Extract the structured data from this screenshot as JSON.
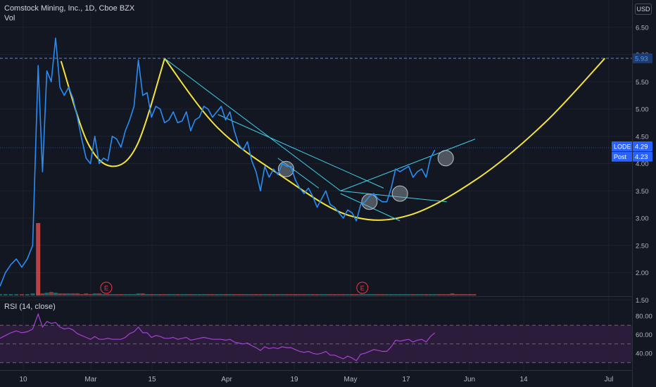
{
  "header": {
    "symbol_title": "Comstock Mining, Inc., 1D, Cboe BZX",
    "volume_label": "Vol",
    "currency": "USD"
  },
  "colors": {
    "background": "#131722",
    "price_line": "#2a8cf3",
    "cup_curve": "#f5e43a",
    "trendline": "#3fd0e8",
    "volume_up": "#26a69a",
    "volume_down": "#ef5350",
    "rsi_line": "#a742d3",
    "rsi_band": "#2d1d3d",
    "earnings_marker": "#f23645",
    "axis_label_bg": "#2962ff"
  },
  "chart_data": [
    {
      "type": "line",
      "title": "Comstock Mining, Inc., 1D, Cboe BZX",
      "series_name": "LODE",
      "y_axis": {
        "ticks": [
          "6.50",
          "6.00",
          "5.50",
          "5.00",
          "4.50",
          "4.00",
          "3.50",
          "3.00",
          "2.50",
          "2.00",
          "1.50"
        ],
        "ylim": [
          1.4,
          6.6
        ],
        "scale": "linear"
      },
      "x_axis": {
        "tick_labels": [
          "10",
          "Mar",
          "15",
          "Apr",
          "19",
          "May",
          "17",
          "Jun",
          "14",
          "Jul"
        ],
        "xlim": [
          0,
          116
        ]
      },
      "price": {
        "x": [
          0,
          1,
          2,
          3,
          4,
          5,
          6,
          7,
          7.8,
          8.6,
          9.4,
          10.2,
          11,
          11.8,
          12.6,
          13.4,
          14.2,
          15,
          15.8,
          16.6,
          17.4,
          18.2,
          19,
          19.8,
          20.6,
          21.4,
          22.2,
          23,
          23.8,
          24.6,
          25.4,
          26.2,
          27,
          27.8,
          28.6,
          29.4,
          30.2,
          31,
          31.8,
          32.6,
          33.4,
          34.2,
          35,
          35.8,
          36.6,
          37.4,
          38.2,
          39,
          39.8,
          40.6,
          41.4,
          42.2,
          43,
          43.8,
          44.6,
          45.4,
          46.2,
          47,
          47.8,
          48.6,
          49.4,
          50.2,
          51,
          51.8,
          52.6,
          53.4,
          54.2,
          55,
          55.8,
          56.6,
          57.4,
          58.2,
          59,
          59.8,
          60.6,
          61.4,
          62.2,
          63,
          63.8,
          64.6,
          65.4,
          66.2,
          67,
          67.8,
          68.6,
          69.4,
          70.2,
          71,
          71.8,
          72.6,
          73.4,
          74.2,
          75,
          75.8,
          76.6,
          77.4,
          78.2,
          79,
          79.8,
          80.6,
          81.4,
          82.2,
          83,
          83.8,
          84.6,
          85.4,
          86.2,
          87
        ],
        "close": [
          1.75,
          2.0,
          2.15,
          2.25,
          2.1,
          2.25,
          2.5,
          5.8,
          3.85,
          5.7,
          5.5,
          6.3,
          5.4,
          5.25,
          5.4,
          5.2,
          4.85,
          4.45,
          4.1,
          4.0,
          4.5,
          4.0,
          4.1,
          4.05,
          4.5,
          4.45,
          4.3,
          4.6,
          4.8,
          5.05,
          5.9,
          5.25,
          5.3,
          4.85,
          5.05,
          5.0,
          4.75,
          4.8,
          4.95,
          4.75,
          4.78,
          4.95,
          4.6,
          4.8,
          4.85,
          5.05,
          5.0,
          4.85,
          4.95,
          5.05,
          4.8,
          4.95,
          4.6,
          4.35,
          4.25,
          4.4,
          4.05,
          3.85,
          3.5,
          3.95,
          3.75,
          3.9,
          3.8,
          4.0,
          3.95,
          3.95,
          3.7,
          3.55,
          3.45,
          3.55,
          3.4,
          3.2,
          3.35,
          3.5,
          3.25,
          3.2,
          3.1,
          3.0,
          3.15,
          3.1,
          2.95,
          3.25,
          3.3,
          3.4,
          3.45,
          3.35,
          3.3,
          3.3,
          3.55,
          3.9,
          3.85,
          3.9,
          3.95,
          3.75,
          3.85,
          3.9,
          3.75,
          4.1,
          4.25
        ]
      },
      "annotations": {
        "resistance_level": 5.93,
        "resistance_label": "5.93",
        "last_price_label": "4.29",
        "post_price_label": "4.23",
        "symbol_label": "LODE",
        "post_label": "Post",
        "last_price": 4.29,
        "post_price": 4.23,
        "small_cup": [
          [
            11.2,
            5.88
          ],
          [
            16,
            4.4
          ],
          [
            20.6,
            3.95
          ],
          [
            25.2,
            4.35
          ],
          [
            30.2,
            5.92
          ]
        ],
        "large_cup": [
          [
            30.2,
            5.93
          ],
          [
            40,
            4.65
          ],
          [
            52,
            3.75
          ],
          [
            64,
            3.05
          ],
          [
            75,
            3.05
          ],
          [
            88,
            3.75
          ],
          [
            100,
            4.75
          ],
          [
            111,
            5.93
          ]
        ],
        "trendlines": [
          [
            [
              30.2,
              5.93
            ],
            [
              62.5,
              3.5
            ]
          ],
          [
            [
              40,
              4.9
            ],
            [
              70.4,
              3.55
            ]
          ],
          [
            [
              51,
              4.1
            ],
            [
              58.5,
              3.55
            ]
          ],
          [
            [
              62.5,
              3.5
            ],
            [
              87.2,
              4.45
            ]
          ],
          [
            [
              62.5,
              3.5
            ],
            [
              82,
              3.3
            ]
          ],
          [
            [
              62.5,
              3.45
            ],
            [
              73.4,
              2.95
            ]
          ]
        ],
        "highlight_circles": [
          [
            52.5,
            3.9
          ],
          [
            67.8,
            3.3
          ],
          [
            73.4,
            3.45
          ],
          [
            81.8,
            4.1
          ]
        ]
      }
    },
    {
      "type": "bar",
      "title": "Vol",
      "highlighted_bar_index": 7,
      "bar_x": [
        0,
        1,
        2,
        3,
        4,
        5,
        6,
        7,
        7.8,
        8.6,
        9.4,
        10.2,
        11,
        11.8,
        12.6,
        13.4,
        14.2,
        15,
        15.8,
        16.6,
        17.4,
        18.2,
        19,
        19.8,
        20.6,
        21.4,
        22.2,
        23,
        23.8,
        24.6,
        25.4,
        26.2,
        27,
        27.8,
        28.6,
        29.4,
        30.2,
        31,
        31.8,
        32.6,
        33.4,
        34.2,
        35,
        35.8,
        36.6,
        37.4,
        38.2,
        39,
        39.8,
        40.6,
        41.4,
        42.2,
        43,
        43.8,
        44.6,
        45.4,
        46.2,
        47,
        47.8,
        48.6,
        49.4,
        50.2,
        51,
        51.8,
        52.6,
        53.4,
        54.2,
        55,
        55.8,
        56.6,
        57.4,
        58.2,
        59,
        59.8,
        60.6,
        61.4,
        62.2,
        63,
        63.8,
        64.6,
        65.4,
        66.2,
        67,
        67.8,
        68.6,
        69.4,
        70.2,
        71,
        71.8,
        72.6,
        73.4,
        74.2,
        75,
        75.8,
        76.6,
        77.4,
        78.2,
        79,
        79.8,
        80.6,
        81.4,
        82.2,
        83,
        83.8,
        84.6,
        85.4,
        86.2,
        87
      ],
      "volume_relative": [
        0.02,
        0.02,
        0.02,
        0.02,
        0.02,
        0.02,
        0.03,
        1.0,
        0.03,
        0.04,
        0.05,
        0.04,
        0.03,
        0.03,
        0.03,
        0.03,
        0.03,
        0.02,
        0.03,
        0.02,
        0.03,
        0.03,
        0.02,
        0.02,
        0.02,
        0.02,
        0.02,
        0.02,
        0.02,
        0.02,
        0.03,
        0.03,
        0.02,
        0.02,
        0.02,
        0.02,
        0.02,
        0.02,
        0.02,
        0.02,
        0.02,
        0.02,
        0.02,
        0.02,
        0.02,
        0.02,
        0.02,
        0.02,
        0.02,
        0.02,
        0.02,
        0.02,
        0.02,
        0.02,
        0.02,
        0.02,
        0.02,
        0.02,
        0.02,
        0.02,
        0.02,
        0.02,
        0.02,
        0.02,
        0.02,
        0.02,
        0.02,
        0.02,
        0.02,
        0.02,
        0.02,
        0.02,
        0.02,
        0.02,
        0.02,
        0.02,
        0.02,
        0.02,
        0.02,
        0.02,
        0.02,
        0.02,
        0.02,
        0.02,
        0.02,
        0.02,
        0.02,
        0.02,
        0.02,
        0.02,
        0.02,
        0.02,
        0.02,
        0.02,
        0.02,
        0.02,
        0.02,
        0.02,
        0.02,
        0.02,
        0.02,
        0.02,
        0.03,
        0.02,
        0.02,
        0.02,
        0.02,
        0.02,
        0.02
      ],
      "volume_up": [
        true,
        true,
        true,
        true,
        false,
        true,
        true,
        false,
        false,
        true,
        false,
        true,
        false,
        false,
        true,
        false,
        false,
        false,
        false,
        false,
        true,
        false,
        true,
        false,
        true,
        false,
        false,
        true,
        true,
        true,
        true,
        false,
        true,
        false,
        true,
        false,
        false,
        true,
        true,
        false,
        true,
        true,
        false,
        true,
        true,
        true,
        false,
        false,
        true,
        true,
        false,
        true,
        false,
        false,
        false,
        true,
        false,
        false,
        false,
        true,
        false,
        true,
        false,
        true,
        false,
        false,
        false,
        false,
        false,
        true,
        false,
        false,
        true,
        true,
        false,
        false,
        false,
        false,
        true,
        false,
        false,
        true,
        true,
        true,
        true,
        false,
        false,
        true,
        true,
        true,
        true,
        true,
        true,
        false,
        true,
        true,
        false,
        true,
        true
      ],
      "earnings_markers": [
        {
          "x": 19.5,
          "label": "E"
        },
        {
          "x": 66.5,
          "label": "E"
        }
      ]
    },
    {
      "type": "line",
      "title": "RSI (14, close)",
      "y_axis": {
        "ticks": [
          "80.00",
          "60.00",
          "40.00"
        ],
        "ylim": [
          28,
          86
        ],
        "upper_band": 70,
        "lower_band": 30,
        "middle": 50
      },
      "rsi": {
        "x": [
          0,
          1,
          2,
          3,
          4,
          5,
          6,
          7,
          7.8,
          8.6,
          9.4,
          10.2,
          11,
          11.8,
          12.6,
          13.4,
          14.2,
          15,
          15.8,
          16.6,
          17.4,
          18.2,
          19,
          19.8,
          20.6,
          21.4,
          22.2,
          23,
          23.8,
          24.6,
          25.4,
          26.2,
          27,
          27.8,
          28.6,
          29.4,
          30.2,
          31,
          31.8,
          32.6,
          33.4,
          34.2,
          35,
          35.8,
          36.6,
          37.4,
          38.2,
          39,
          39.8,
          40.6,
          41.4,
          42.2,
          43,
          43.8,
          44.6,
          45.4,
          46.2,
          47,
          47.8,
          48.6,
          49.4,
          50.2,
          51,
          51.8,
          52.6,
          53.4,
          54.2,
          55,
          55.8,
          56.6,
          57.4,
          58.2,
          59,
          59.8,
          60.6,
          61.4,
          62.2,
          63,
          63.8,
          64.6,
          65.4,
          66.2,
          67,
          67.8,
          68.6,
          69.4,
          70.2,
          71,
          71.8,
          72.6,
          73.4,
          74.2,
          75,
          75.8,
          76.6,
          77.4,
          78.2,
          79,
          79.8,
          80.6,
          81.4,
          82.2,
          83,
          83.8,
          84.6,
          85.4,
          86.2,
          87
        ],
        "values": [
          56,
          59,
          62,
          64,
          62,
          63,
          66,
          82,
          68,
          74,
          72,
          73,
          68,
          66,
          67,
          65,
          61,
          59,
          57,
          55,
          58,
          55,
          55,
          56,
          55,
          55,
          55,
          57,
          61,
          63,
          68,
          62,
          62,
          57,
          59,
          58,
          56,
          56,
          57,
          55,
          56,
          57,
          54,
          55,
          56,
          57,
          56,
          55,
          55,
          55,
          54,
          55,
          52,
          51,
          50,
          51,
          48,
          46,
          43,
          47,
          45,
          46,
          45,
          47,
          46,
          46,
          44,
          42,
          41,
          42,
          40,
          39,
          40,
          42,
          38,
          38,
          36,
          34,
          37,
          35,
          32,
          39,
          40,
          42,
          44,
          43,
          42,
          42,
          47,
          54,
          53,
          54,
          55,
          52,
          54,
          55,
          52,
          58,
          62
        ]
      }
    }
  ]
}
